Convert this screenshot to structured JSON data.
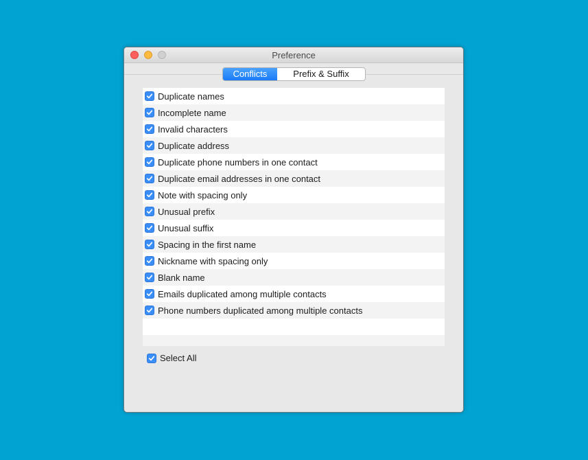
{
  "window": {
    "title": "Preference"
  },
  "tabs": [
    {
      "label": "Conflicts",
      "active": true
    },
    {
      "label": "Prefix & Suffix",
      "active": false
    }
  ],
  "items": [
    {
      "label": "Duplicate names",
      "checked": true
    },
    {
      "label": "Incomplete name",
      "checked": true
    },
    {
      "label": "Invalid characters",
      "checked": true
    },
    {
      "label": "Duplicate address",
      "checked": true
    },
    {
      "label": "Duplicate phone numbers in one contact",
      "checked": true
    },
    {
      "label": "Duplicate email addresses in one contact",
      "checked": true
    },
    {
      "label": "Note with spacing only",
      "checked": true
    },
    {
      "label": "Unusual prefix",
      "checked": true
    },
    {
      "label": "Unusual suffix",
      "checked": true
    },
    {
      "label": "Spacing in the first name",
      "checked": true
    },
    {
      "label": "Nickname with spacing only",
      "checked": true
    },
    {
      "label": "Blank name",
      "checked": true
    },
    {
      "label": "Emails duplicated among multiple contacts",
      "checked": true
    },
    {
      "label": "Phone numbers duplicated among multiple contacts",
      "checked": true
    }
  ],
  "select_all": {
    "label": "Select All",
    "checked": true
  },
  "colors": {
    "background": "#00a3d2",
    "accent": "#3a8ef8"
  }
}
